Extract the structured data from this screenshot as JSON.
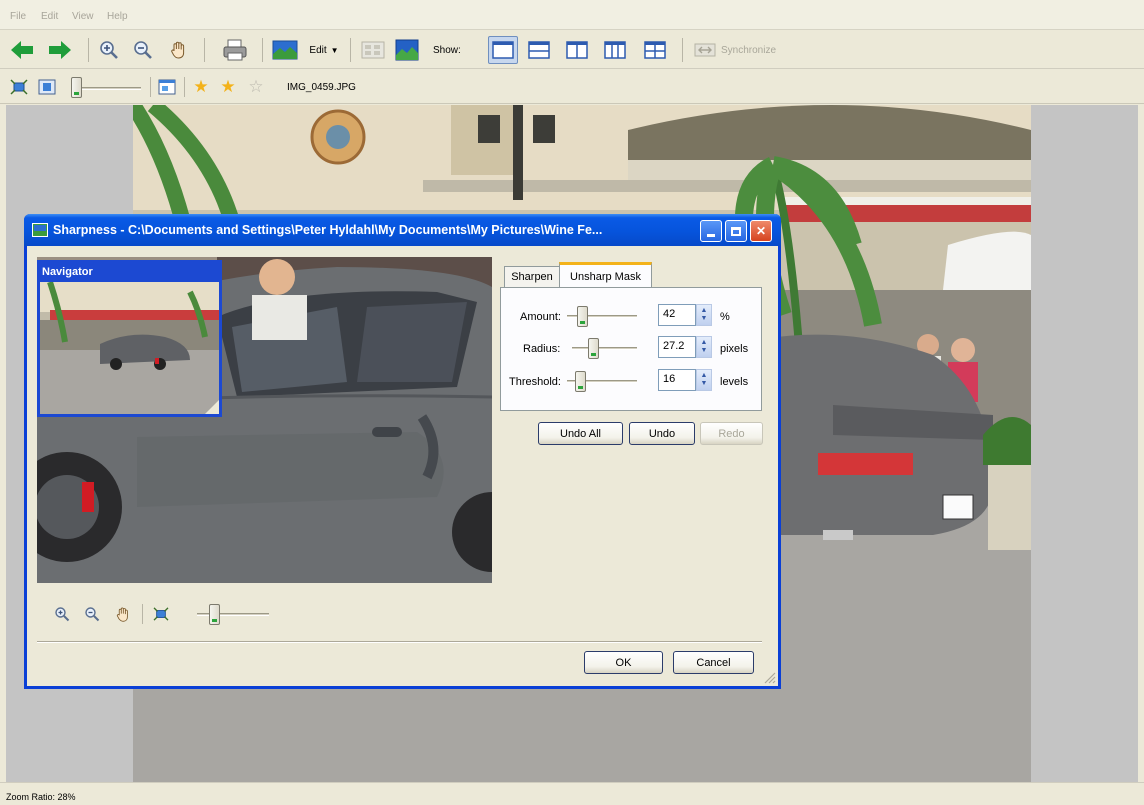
{
  "menu": {
    "file": "File",
    "edit": "Edit",
    "view": "View",
    "help": "Help"
  },
  "toolbar": {
    "edit_label": "Edit",
    "show_label": "Show:",
    "synchronize_label": "Synchronize"
  },
  "toolbar2": {
    "filename": "IMG_0459.JPG",
    "rating_stars": 2
  },
  "dialog": {
    "title": "Sharpness - C:\\Documents and Settings\\Peter Hyldahl\\My Documents\\My Pictures\\Wine Fe...",
    "navigator_label": "Navigator",
    "tabs": [
      "Sharpen",
      "Unsharp Mask"
    ],
    "active_tab": "Unsharp Mask",
    "params": [
      {
        "label": "Amount:",
        "value": "42",
        "unit": "%",
        "slider_position": 0.1
      },
      {
        "label": "Radius:",
        "value": "27.2",
        "unit": "pixels",
        "slider_position": 0.25
      },
      {
        "label": "Threshold:",
        "value": "16",
        "unit": "levels",
        "slider_position": 0.08
      }
    ],
    "undo_all_label": "Undo All",
    "undo_label": "Undo",
    "redo_label": "Redo",
    "ok_label": "OK",
    "cancel_label": "Cancel",
    "zoom_slider_position": 0.25
  },
  "status": {
    "zoom_ratio": "Zoom Ratio: 28%"
  },
  "colors": {
    "title_bar": "#0654dc",
    "window_face": "#ece9d8",
    "close_button": "#e0532f",
    "arrow_green": "#1f9d3a"
  }
}
